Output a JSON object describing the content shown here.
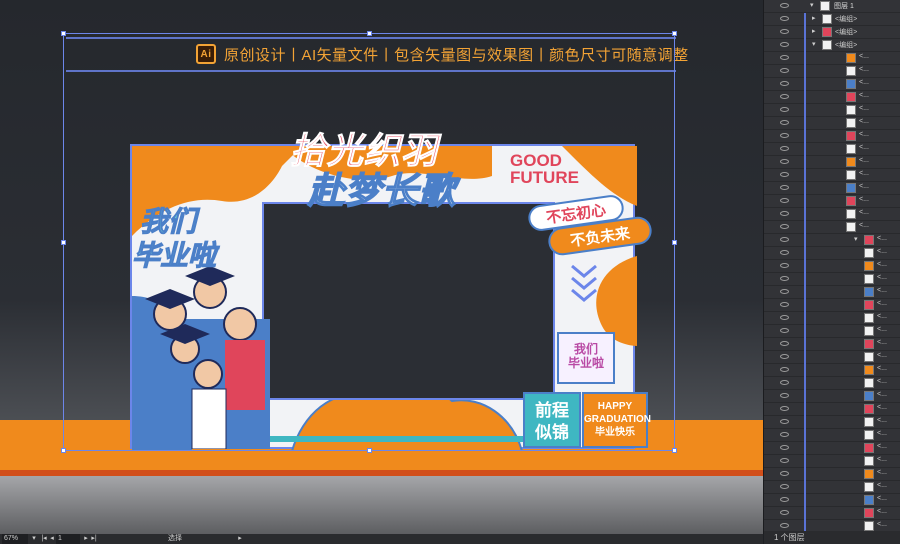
{
  "banner": {
    "ai_logo": "Ai",
    "text": "原创设计丨AI矢量文件丨包含矢量图与效果图丨颜色尺寸可随意调整"
  },
  "artwork": {
    "title_main": "拾光织羽",
    "title_sub": "赴梦长歌",
    "good": "GOOD",
    "future": "FUTURE",
    "pill1": "不忘初心",
    "pill2": "不负未来",
    "left_title1": "我们",
    "left_title2": "毕业啦",
    "mini_sign_line1": "我们",
    "mini_sign_line2": "毕业啦",
    "teal_line1": "前程",
    "teal_line2": "似锦",
    "orange_line1": "HAPPY",
    "orange_line2": "GRADUATION",
    "orange_line3": "毕业快乐"
  },
  "layers": {
    "top_label": "图层 1",
    "group_label": "<编组>",
    "item_label": "<...",
    "footer": "1 个图层"
  },
  "statusbar": {
    "zoom": "67%",
    "page": "1",
    "tool": "选择"
  },
  "colors": {
    "accent_orange": "#f08a1c",
    "accent_red": "#e0455b",
    "accent_blue": "#4b7fc8",
    "teal": "#3fb7c2",
    "selection": "#6c86ea"
  }
}
